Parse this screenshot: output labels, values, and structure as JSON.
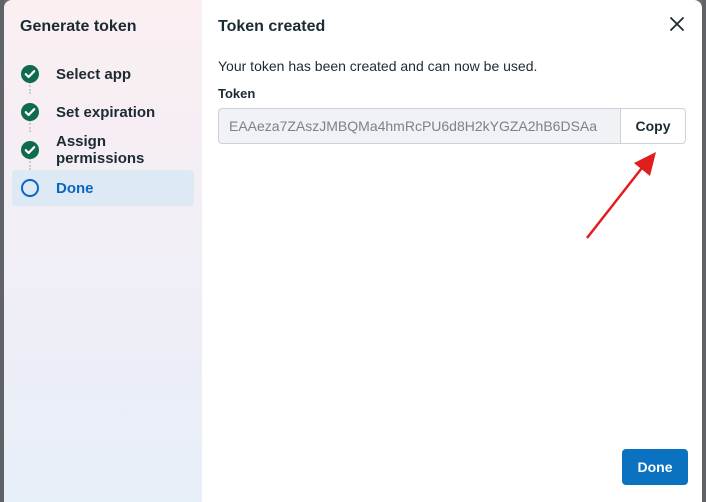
{
  "stepper": {
    "title": "Generate token",
    "steps": [
      {
        "label": "Select app",
        "status": "complete",
        "icon": "check-circle-icon"
      },
      {
        "label": "Set expiration",
        "status": "complete",
        "icon": "check-circle-icon"
      },
      {
        "label": "Assign permissions",
        "status": "complete",
        "icon": "check-circle-icon"
      },
      {
        "label": "Done",
        "status": "current",
        "icon": "empty-circle-icon"
      }
    ]
  },
  "panel": {
    "title": "Token created",
    "description": "Your token has been created and can now be used.",
    "token_label": "Token",
    "token_value": "EAAeza7ZAszJMBQMa4hmRcPU6d8H2kYGZA2hB6DSAa",
    "copy_label": "Copy",
    "done_label": "Done",
    "close_icon": "close-icon"
  },
  "colors": {
    "complete": "#0f6b4f",
    "current": "#0a66c2",
    "primary_button": "#0b72c2",
    "annotation_arrow": "#e01e1e"
  }
}
